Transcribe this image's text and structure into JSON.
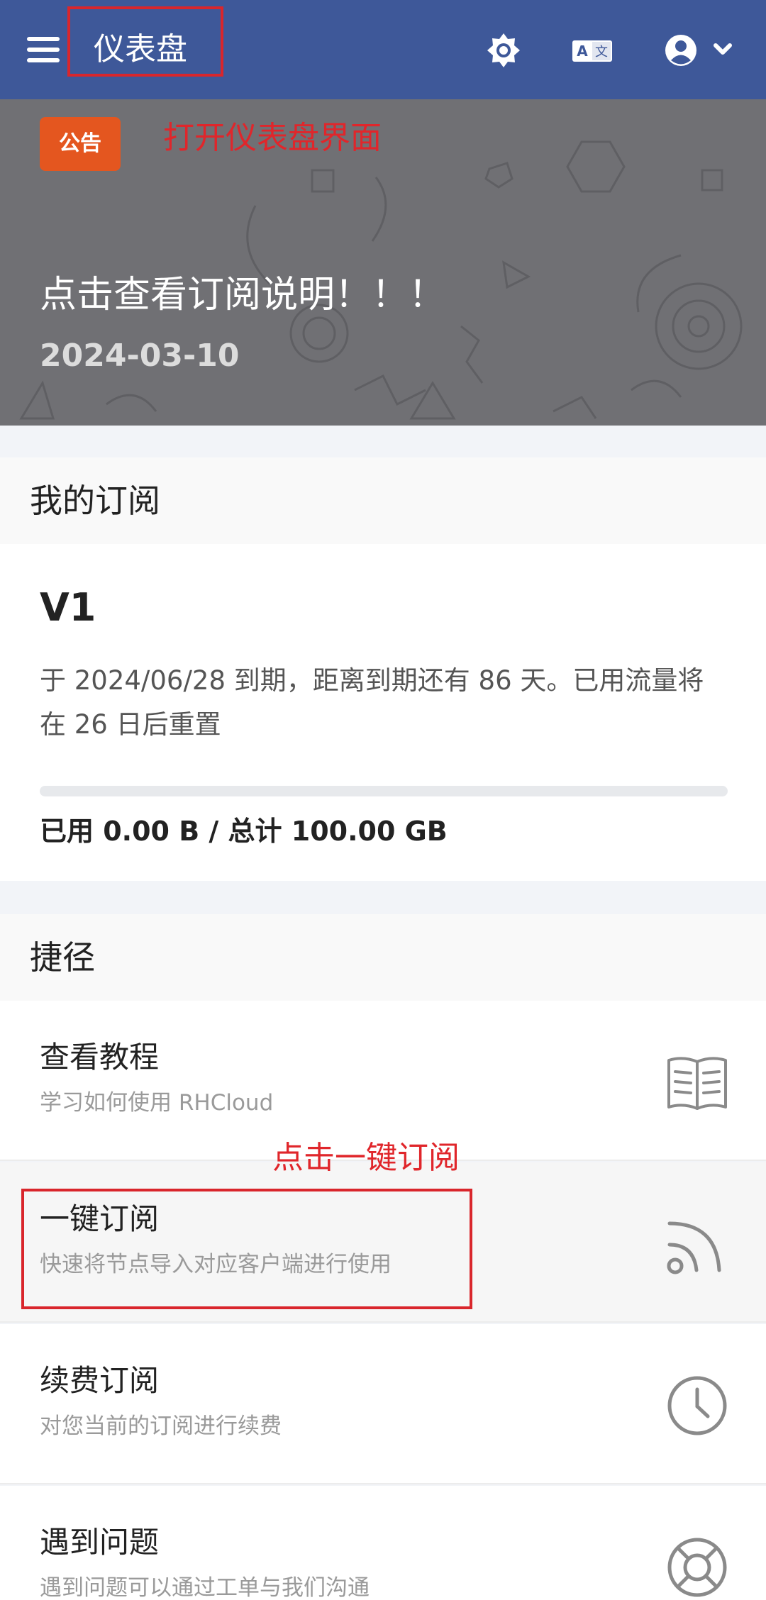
{
  "appbar": {
    "title": "仪表盘",
    "icons": [
      "menu-icon",
      "brightness-icon",
      "translate-icon",
      "account-circle-icon",
      "chevron-down-icon"
    ]
  },
  "notice": {
    "badge": "公告",
    "title": "点击查看订阅说明！！！",
    "date": "2024-03-10"
  },
  "annotations": {
    "open_dashboard": "打开仪表盘界面",
    "click_subscribe": "点击一键订阅"
  },
  "subscription": {
    "header": "我的订阅",
    "plan": "V1",
    "expiry_text": "于 2024/06/28 到期，距离到期还有 86 天。已用流量将在 26 日后重置",
    "usage_text": "已用 0.00 B / 总计 100.00 GB",
    "usage_fraction": 0.0
  },
  "shortcuts": {
    "header": "捷径",
    "items": [
      {
        "title": "查看教程",
        "desc": "学习如何使用 RHCloud",
        "icon": "book-icon"
      },
      {
        "title": "一键订阅",
        "desc": "快速将节点导入对应客户端进行使用",
        "icon": "rss-feed-icon"
      },
      {
        "title": "续费订阅",
        "desc": "对您当前的订阅进行续费",
        "icon": "clock-icon"
      },
      {
        "title": "遇到问题",
        "desc": "遇到问题可以通过工单与我们沟通",
        "icon": "lifebuoy-icon"
      }
    ]
  },
  "colors": {
    "appbar": "#3e5899",
    "badge": "#e4561f",
    "annotation": "#e0262b",
    "banner": "#707074"
  }
}
